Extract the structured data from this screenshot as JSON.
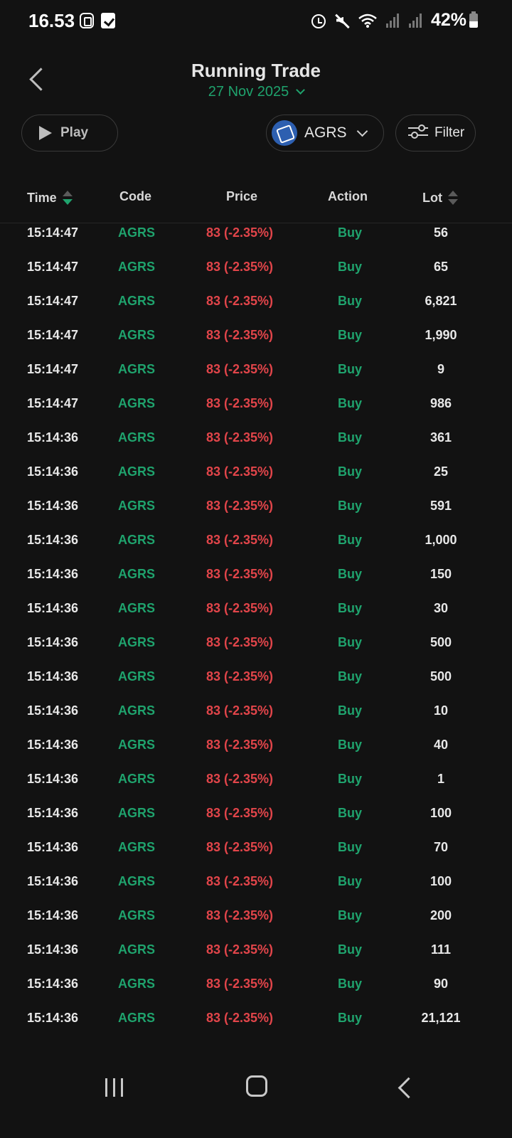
{
  "status_bar": {
    "time": "16.53",
    "battery": "42%",
    "icons": [
      "app-icon",
      "check-icon",
      "alarm-icon",
      "mute-icon",
      "wifi-icon",
      "signal-icon",
      "signal-icon",
      "battery-icon"
    ]
  },
  "header": {
    "title": "Running Trade",
    "date": "27 Nov 2025"
  },
  "controls": {
    "play_label": "Play",
    "stock_code": "AGRS",
    "filter_label": "Filter"
  },
  "table": {
    "headers": {
      "time": "Time",
      "code": "Code",
      "price": "Price",
      "action": "Action",
      "lot": "Lot"
    },
    "rows": [
      {
        "time": "15:14:47",
        "code": "AGRS",
        "price": "83 (-2.35%)",
        "action": "Buy",
        "lot": "56"
      },
      {
        "time": "15:14:47",
        "code": "AGRS",
        "price": "83 (-2.35%)",
        "action": "Buy",
        "lot": "65"
      },
      {
        "time": "15:14:47",
        "code": "AGRS",
        "price": "83 (-2.35%)",
        "action": "Buy",
        "lot": "6,821"
      },
      {
        "time": "15:14:47",
        "code": "AGRS",
        "price": "83 (-2.35%)",
        "action": "Buy",
        "lot": "1,990"
      },
      {
        "time": "15:14:47",
        "code": "AGRS",
        "price": "83 (-2.35%)",
        "action": "Buy",
        "lot": "9"
      },
      {
        "time": "15:14:47",
        "code": "AGRS",
        "price": "83 (-2.35%)",
        "action": "Buy",
        "lot": "986"
      },
      {
        "time": "15:14:36",
        "code": "AGRS",
        "price": "83 (-2.35%)",
        "action": "Buy",
        "lot": "361"
      },
      {
        "time": "15:14:36",
        "code": "AGRS",
        "price": "83 (-2.35%)",
        "action": "Buy",
        "lot": "25"
      },
      {
        "time": "15:14:36",
        "code": "AGRS",
        "price": "83 (-2.35%)",
        "action": "Buy",
        "lot": "591"
      },
      {
        "time": "15:14:36",
        "code": "AGRS",
        "price": "83 (-2.35%)",
        "action": "Buy",
        "lot": "1,000"
      },
      {
        "time": "15:14:36",
        "code": "AGRS",
        "price": "83 (-2.35%)",
        "action": "Buy",
        "lot": "150"
      },
      {
        "time": "15:14:36",
        "code": "AGRS",
        "price": "83 (-2.35%)",
        "action": "Buy",
        "lot": "30"
      },
      {
        "time": "15:14:36",
        "code": "AGRS",
        "price": "83 (-2.35%)",
        "action": "Buy",
        "lot": "500"
      },
      {
        "time": "15:14:36",
        "code": "AGRS",
        "price": "83 (-2.35%)",
        "action": "Buy",
        "lot": "500"
      },
      {
        "time": "15:14:36",
        "code": "AGRS",
        "price": "83 (-2.35%)",
        "action": "Buy",
        "lot": "10"
      },
      {
        "time": "15:14:36",
        "code": "AGRS",
        "price": "83 (-2.35%)",
        "action": "Buy",
        "lot": "40"
      },
      {
        "time": "15:14:36",
        "code": "AGRS",
        "price": "83 (-2.35%)",
        "action": "Buy",
        "lot": "1"
      },
      {
        "time": "15:14:36",
        "code": "AGRS",
        "price": "83 (-2.35%)",
        "action": "Buy",
        "lot": "100"
      },
      {
        "time": "15:14:36",
        "code": "AGRS",
        "price": "83 (-2.35%)",
        "action": "Buy",
        "lot": "70"
      },
      {
        "time": "15:14:36",
        "code": "AGRS",
        "price": "83 (-2.35%)",
        "action": "Buy",
        "lot": "100"
      },
      {
        "time": "15:14:36",
        "code": "AGRS",
        "price": "83 (-2.35%)",
        "action": "Buy",
        "lot": "200"
      },
      {
        "time": "15:14:36",
        "code": "AGRS",
        "price": "83 (-2.35%)",
        "action": "Buy",
        "lot": "111"
      },
      {
        "time": "15:14:36",
        "code": "AGRS",
        "price": "83 (-2.35%)",
        "action": "Buy",
        "lot": "90"
      },
      {
        "time": "15:14:36",
        "code": "AGRS",
        "price": "83 (-2.35%)",
        "action": "Buy",
        "lot": "21,121"
      }
    ]
  },
  "colors": {
    "background": "#121212",
    "up_green": "#1fa36d",
    "down_red": "#e2454a"
  },
  "nav_bar": {
    "icons": [
      "recents-icon",
      "home-icon",
      "back-icon"
    ]
  }
}
